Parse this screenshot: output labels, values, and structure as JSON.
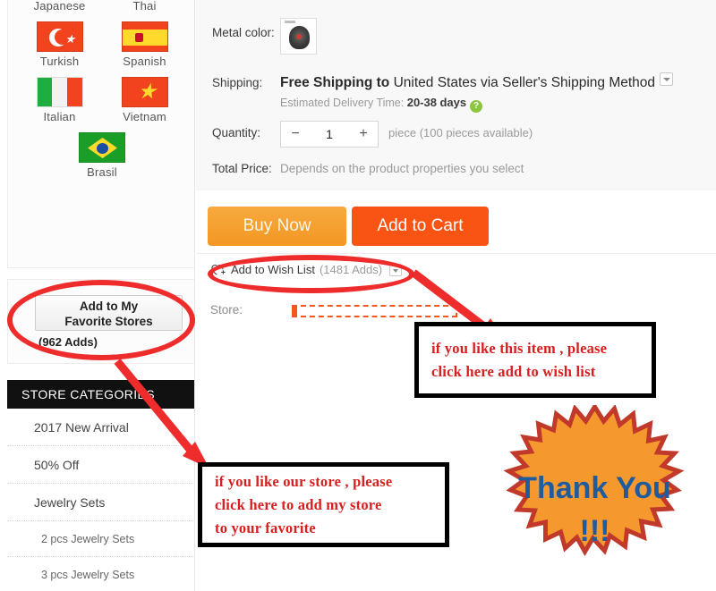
{
  "sidebar": {
    "languages": [
      {
        "name": "Japanese",
        "flag": "jp-flag-icon",
        "row": "top-label"
      },
      {
        "name": "Thai",
        "flag": "th-flag-icon",
        "row": "top-label"
      },
      {
        "name": "Turkish",
        "flag": "tr-flag-icon"
      },
      {
        "name": "Spanish",
        "flag": "es-flag-icon"
      },
      {
        "name": "Italian",
        "flag": "it-flag-icon"
      },
      {
        "name": "Vietnam",
        "flag": "vn-flag-icon"
      },
      {
        "name": "Brasil",
        "flag": "br-flag-icon"
      }
    ],
    "favorite": {
      "button_label_line1": "Add to My",
      "button_label_line2": "Favorite Stores",
      "adds_count": "(962 Adds)"
    },
    "categories": {
      "header": "STORE CATEGORIES",
      "items": [
        {
          "label": "2017 New Arrival",
          "sub": false
        },
        {
          "label": "50% Off",
          "sub": false
        },
        {
          "label": "Jewelry Sets",
          "sub": false
        },
        {
          "label": "2 pcs Jewelry Sets",
          "sub": true
        },
        {
          "label": "3 pcs Jewelry Sets",
          "sub": true
        }
      ]
    }
  },
  "product": {
    "metal_color_label": "Metal color:",
    "metal_color_swatch": "jewelry-thumbnail",
    "shipping_label": "Shipping:",
    "shipping_free": "Free Shipping to",
    "shipping_dest": " United States via Seller's Shipping Method",
    "shipping_caret": "chevron-down-icon",
    "delivery_prefix": "Estimated Delivery Time:",
    "delivery_value": "20-38",
    "delivery_suffix": "days",
    "help_icon": "question-mark-icon",
    "quantity_label": "Quantity:",
    "quantity_minus": "−",
    "quantity_value": "1",
    "quantity_plus": "+",
    "quantity_unit": "piece (100 pieces available)",
    "total_price_label": "Total Price:",
    "total_price_value": "Depends on the product properties you select",
    "buy_now": "Buy Now",
    "add_to_cart": "Add to Cart",
    "wish_icon": "heart-plus-icon",
    "wish_label": "Add to Wish List",
    "wish_count": "(1481 Adds)",
    "wish_caret": "chevron-down-icon",
    "store_label": "Store:"
  },
  "annotations": {
    "wish_note": {
      "line1": "if  you like this item , please",
      "line2": "click here add to wish list"
    },
    "store_note": {
      "line1": "if  you like our store , please",
      "line2": "click here to add my store",
      "line3": "to your favorite"
    },
    "thanks": {
      "line1": "Thank You",
      "line2": "!!!"
    }
  },
  "colors": {
    "buy_now": "#F39723",
    "add_to_cart": "#FA5414",
    "annotation_red": "#D81E1E",
    "marker_red": "#EE2C2C",
    "starburst_fill": "#F5982E",
    "starburst_edge": "#C0392B",
    "thanks_text": "#1F5C9E",
    "help_green": "#8CC63E",
    "category_header_bg": "#111111"
  }
}
